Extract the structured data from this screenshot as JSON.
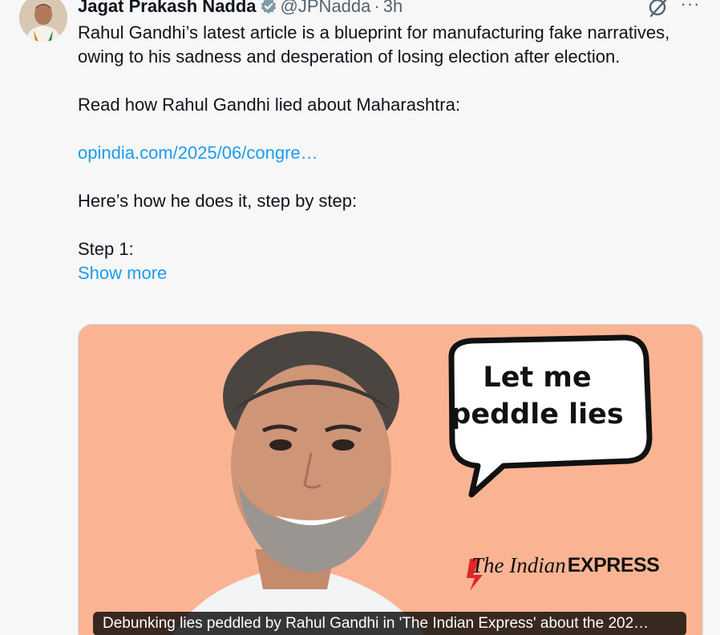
{
  "tweet": {
    "author": {
      "display_name": "Jagat Prakash Nadda",
      "handle": "@JPNadda",
      "separator": "·",
      "time": "3h",
      "verified_icon": "verified-badge-icon",
      "verified_color": "#829aab"
    },
    "actions": {
      "grok_icon": "grok-icon",
      "more_label": "···"
    },
    "body": {
      "paragraph_1": "Rahul Gandhi’s latest article is a blueprint for manufacturing fake narratives, owing to his sadness and desperation of losing election after election.",
      "paragraph_2": "Read how Rahul Gandhi lied about Maharashtra:",
      "link": "opindia.com/2025/06/congre…",
      "paragraph_3": "Here’s how he does it, step by step:",
      "paragraph_4": "Step 1:",
      "show_more": "Show more"
    },
    "media": {
      "speech_bubble_line_1": "Let me",
      "speech_bubble_line_2": "peddle lies",
      "brand_name": "The Indian",
      "brand_strong": "EXPRESS",
      "caption": "Debunking lies peddled by Rahul Gandhi in 'The Indian Express' about the 202…",
      "background_color": "#fbb493"
    },
    "colors": {
      "link": "#1d9bf0",
      "text": "#0f1419",
      "secondary": "#536471",
      "brand_red": "#e4242b"
    }
  }
}
